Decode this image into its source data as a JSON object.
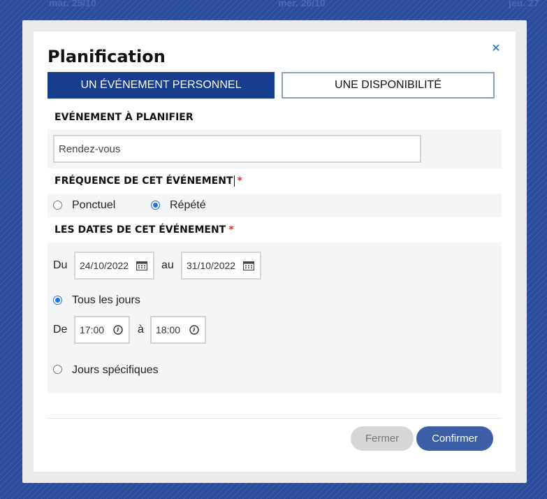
{
  "background": {
    "day_headers": [
      "mar. 25/10",
      "mer. 26/10",
      "jeu. 27"
    ]
  },
  "modal": {
    "title": "Planification",
    "close_icon": "close-icon",
    "tabs": [
      {
        "label": "UN ÉVÉNEMENT PERSONNEL",
        "active": true
      },
      {
        "label": "UNE DISPONIBILITÉ",
        "active": false
      }
    ],
    "event": {
      "label": "EVÉNEMENT À PLANIFIER",
      "value": "Rendez-vous"
    },
    "frequency": {
      "label": "FRÉQUENCE DE CET ÉVÉNEMENT",
      "required_mark": "*",
      "options": [
        {
          "label": "Ponctuel",
          "checked": false
        },
        {
          "label": "Répété",
          "checked": true
        }
      ]
    },
    "dates": {
      "label": "LES DATES DE CET ÉVÉNEMENT",
      "required_mark": "*",
      "from_label": "Du",
      "from_value": "24/10/2022",
      "to_label": "au",
      "to_value": "31/10/2022",
      "every_day": {
        "label": "Tous les jours",
        "checked": true
      },
      "time_from_label": "De",
      "time_from_value": "17:00",
      "time_to_label": "à",
      "time_to_value": "18:00",
      "specific_days": {
        "label": "Jours spécifiques",
        "checked": false
      }
    },
    "buttons": {
      "close_label": "Fermer",
      "confirm_label": "Confirmer"
    }
  },
  "colors": {
    "backdrop": "#2a4c9c",
    "tab_active": "#173d8f",
    "confirm": "#3c5ea6",
    "required": "#d9302a",
    "radio_checked": "#1a73e8"
  }
}
